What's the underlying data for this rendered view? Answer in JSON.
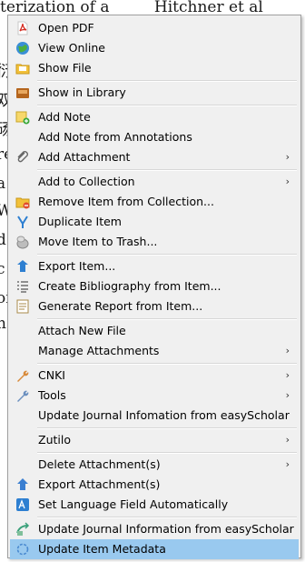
{
  "background": {
    "title_left": "terization of a",
    "title_right": "Hitchner et al",
    "side_glyphs": [
      "衍",
      "双",
      "砀",
      "re",
      "a",
      "W",
      "d",
      "c",
      "oi",
      "n"
    ]
  },
  "menu": {
    "items": [
      {
        "label": "Open PDF"
      },
      {
        "label": "View Online"
      },
      {
        "label": "Show File"
      },
      {
        "label": "Show in Library"
      },
      {
        "label": "Add Note"
      },
      {
        "label": "Add Note from Annotations"
      },
      {
        "label": "Add Attachment",
        "arrow": "›"
      },
      {
        "label": "Add to Collection",
        "arrow": "›"
      },
      {
        "label": "Remove Item from Collection..."
      },
      {
        "label": "Duplicate Item"
      },
      {
        "label": "Move Item to Trash..."
      },
      {
        "label": "Export Item..."
      },
      {
        "label": "Create Bibliography from Item..."
      },
      {
        "label": "Generate Report from Item..."
      },
      {
        "label": "Attach New File"
      },
      {
        "label": "Manage Attachments",
        "arrow": "›"
      },
      {
        "label": "CNKI",
        "arrow": "›"
      },
      {
        "label": "Tools",
        "arrow": "›"
      },
      {
        "label": "Update Journal Infomation from easyScholar"
      },
      {
        "label": "Zutilo",
        "arrow": "›"
      },
      {
        "label": "Delete Attachment(s)",
        "arrow": "›"
      },
      {
        "label": "Export Attachment(s)"
      },
      {
        "label": "Set Language Field Automatically"
      },
      {
        "label": "Update Journal Information from easyScholar"
      },
      {
        "label": "Update Item Metadata"
      }
    ]
  },
  "colors": {
    "menu_bg": "#f0f0f0",
    "highlight": "#99c9ef"
  }
}
